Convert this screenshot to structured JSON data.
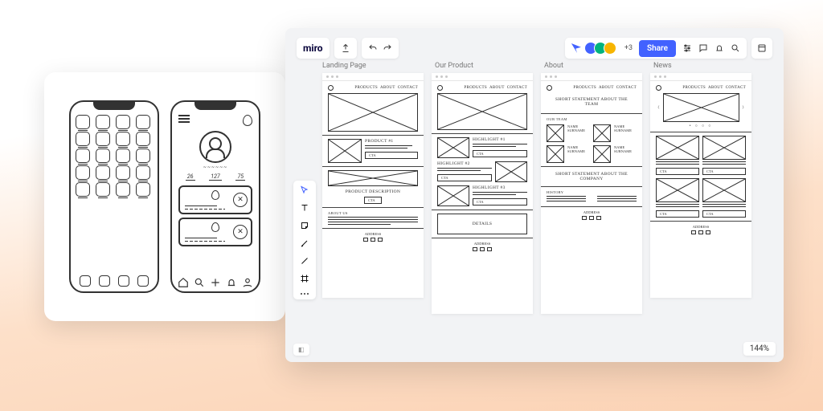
{
  "app": {
    "logo": "miro"
  },
  "topbar": {
    "extra_avatars": "+3",
    "share_label": "Share"
  },
  "frames": {
    "landing": {
      "label": "Landing Page"
    },
    "product": {
      "label": "Our Product"
    },
    "about": {
      "label": "About"
    },
    "news": {
      "label": "News"
    }
  },
  "nav_links": {
    "products": "PRODUCTS",
    "about": "ABOUT",
    "contact": "CONTACT"
  },
  "wire": {
    "product1": "PRODUCT #1",
    "description": "PRODUCT DESCRIPTION",
    "about_us": "ABOUT US",
    "highlight1": "HIGHLIGHT #1",
    "highlight2": "HIGHLIGHT #2",
    "highlight3": "HIGHLIGHT #3",
    "details": "DETAILS",
    "cta": "CTA",
    "team_stmt": "SHORT STATEMENT ABOUT THE TEAM",
    "our_team": "OUR TEAM",
    "member": "NAME SURNAME",
    "company_stmt": "SHORT STATEMENT ABOUT THE COMPANY",
    "history": "HISTORY",
    "address": "ADDRESS"
  },
  "phone2": {
    "stat1": "26",
    "stat2": "127",
    "stat3": "75"
  },
  "footer": {
    "zoom": "144%"
  }
}
